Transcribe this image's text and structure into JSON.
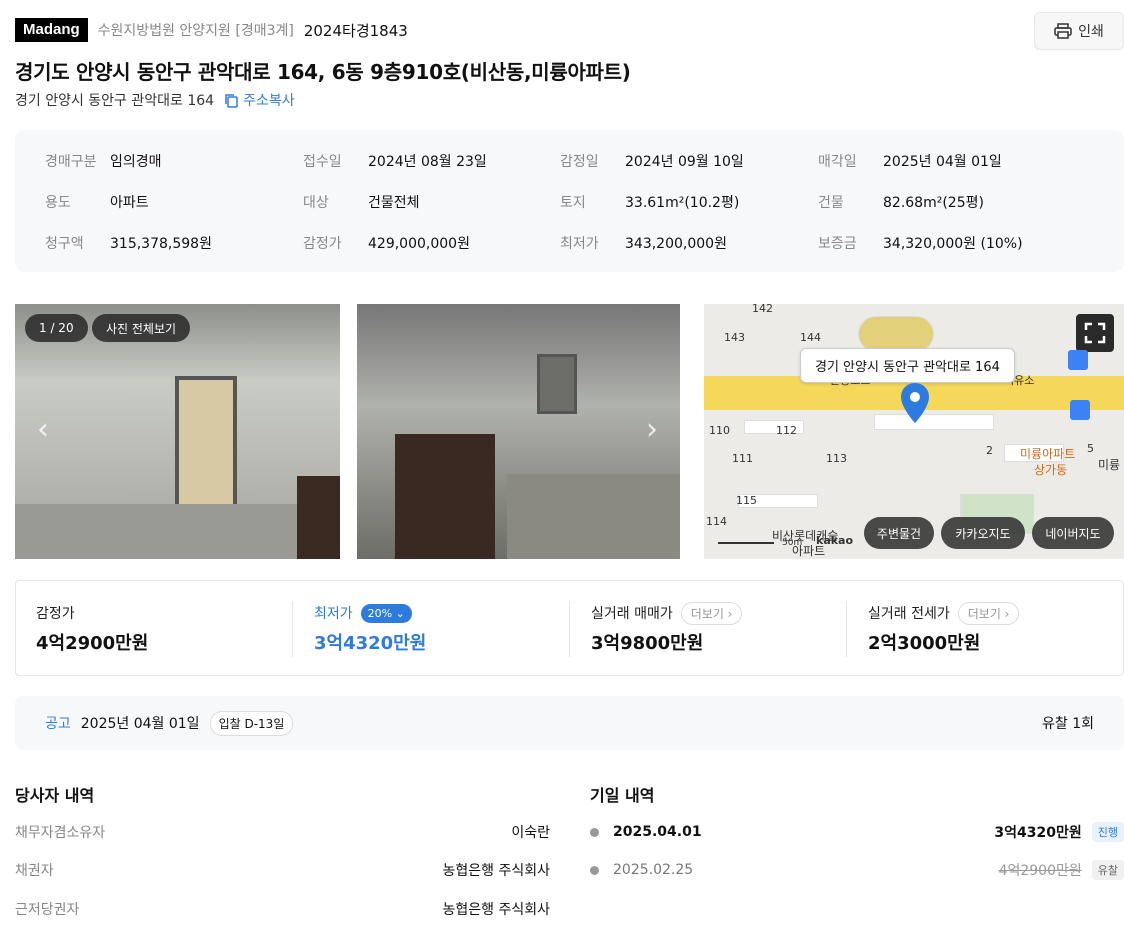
{
  "header": {
    "logo": "Madang",
    "court": "수원지방법원 안양지원 [경매3계]",
    "case_no": "2024타경1843",
    "print_label": "인쇄"
  },
  "title": "경기도 안양시 동안구 관악대로 164, 6동 9층910호(비산동,미륭아파트)",
  "sub_address": "경기 안양시 동안구 관악대로 164",
  "copy_label": "주소복사",
  "info": [
    [
      {
        "k": "경매구분",
        "v": "임의경매"
      },
      {
        "k": "접수일",
        "v": "2024년 08월 23일"
      },
      {
        "k": "감정일",
        "v": "2024년 09월 10일"
      },
      {
        "k": "매각일",
        "v": "2025년 04월 01일"
      }
    ],
    [
      {
        "k": "용도",
        "v": "아파트"
      },
      {
        "k": "대상",
        "v": "건물전체"
      },
      {
        "k": "토지",
        "v": "33.61m²(10.2평)"
      },
      {
        "k": "건물",
        "v": "82.68m²(25평)"
      }
    ],
    [
      {
        "k": "청구액",
        "v": "315,378,598원"
      },
      {
        "k": "감정가",
        "v": "429,000,000원"
      },
      {
        "k": "최저가",
        "v": "343,200,000원"
      },
      {
        "k": "보증금",
        "v": "34,320,000원 (10%)"
      }
    ]
  ],
  "photos": {
    "counter": "1 / 20",
    "view_all": "사진 전체보기"
  },
  "map": {
    "tooltip": "경기 안양시 동안구 관악대로 164",
    "labels": [
      "142",
      "143",
      "144",
      "110",
      "112",
      "111",
      "113",
      "115",
      "114",
      "2",
      "5",
      "미륭아파트",
      "상가동",
      "미륭",
      "비산롯데캐슬",
      "아파트",
      "kakao",
      "50m",
      "분동초교",
      "서유소"
    ],
    "buttons": [
      "주변물건",
      "카카오지도",
      "네이버지도"
    ]
  },
  "prices": [
    {
      "label": "감정가",
      "value": "4억2900만원"
    },
    {
      "label": "최저가",
      "badge": "20% ⌄",
      "value": "3억4320만원"
    },
    {
      "label": "실거래 매매가",
      "more": "더보기 ›",
      "value": "3억9800만원"
    },
    {
      "label": "실거래 전세가",
      "more": "더보기 ›",
      "value": "2억3000만원"
    }
  ],
  "notice": {
    "label": "공고",
    "date": "2025년 04월 01일",
    "dday": "입찰 D-13일",
    "result": "유찰 1회"
  },
  "parties": {
    "title": "당사자 내역",
    "rows": [
      {
        "k": "채무자겸소유자",
        "v": "이숙란"
      },
      {
        "k": "채권자",
        "v": "농협은행 주식회사"
      },
      {
        "k": "근저당권자",
        "v": "농협은행 주식회사"
      }
    ]
  },
  "schedule": {
    "title": "기일 내역",
    "rows": [
      {
        "date": "2025.04.01",
        "price": "3억4320만원",
        "status": "진행"
      },
      {
        "date": "2025.02.25",
        "price": "4억2900만원",
        "status": "유찰"
      }
    ]
  },
  "colors": {
    "accent": "#2e7be0",
    "pin": "#2e7be0",
    "road": "#f5d85a"
  }
}
